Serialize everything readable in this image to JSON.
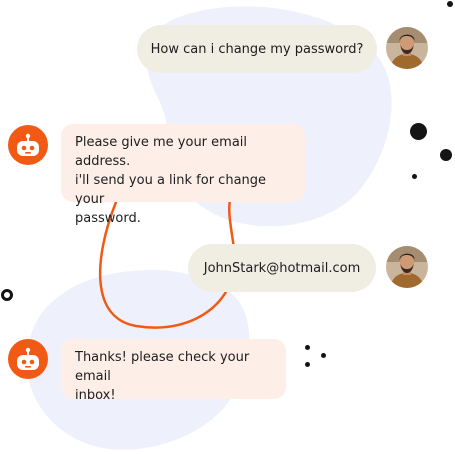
{
  "chat": {
    "messages": [
      {
        "sender": "user",
        "text": "How can i change my password?"
      },
      {
        "sender": "bot",
        "text": "Please give me your email address.\ni'll send you a link for change your\npassword."
      },
      {
        "sender": "user",
        "text": "JohnStark@hotmail.com"
      },
      {
        "sender": "bot",
        "text": "Thanks! please check your email\ninbox!"
      }
    ]
  },
  "colors": {
    "accent": "#f05a14",
    "user_bubble": "#f0ede2",
    "bot_bubble": "#fdefe7",
    "background_blob": "#eef1fb",
    "text": "#1d1d1f"
  },
  "icons": {
    "user_avatar": "user-avatar-photo",
    "bot_avatar": "bot-face-icon"
  }
}
